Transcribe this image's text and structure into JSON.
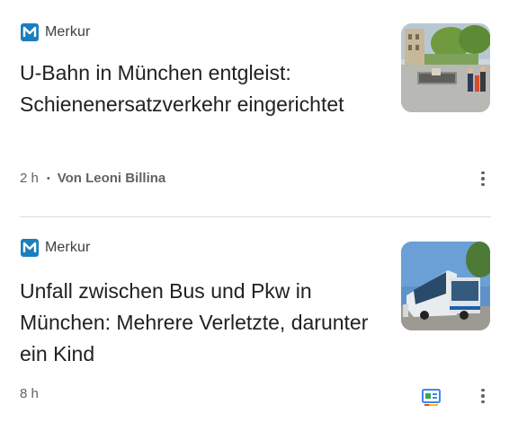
{
  "articles": [
    {
      "source": "Merkur",
      "source_icon": "merkur-logo-icon",
      "headline": "U-Bahn in München entgleist: Schienenersatzverkehr eingerichtet",
      "time": "2 h",
      "separator": "•",
      "author": "Von Leoni Billina",
      "thumbnail": "subway-station-photo",
      "menu_icon": "more-vert-icon"
    },
    {
      "source": "Merkur",
      "source_icon": "merkur-logo-icon",
      "headline": "Unfall zwischen Bus und Pkw in München: Mehrere Verletzte, darunter ein Kind",
      "time": "8 h",
      "thumbnail": "bus-accident-photo",
      "full_coverage_icon": "full-coverage-icon",
      "menu_icon": "more-vert-icon"
    }
  ],
  "colors": {
    "merkur_brand": "#1a7fbf",
    "text_primary": "#202124",
    "text_secondary": "#5f6368",
    "divider": "#dadce0"
  }
}
